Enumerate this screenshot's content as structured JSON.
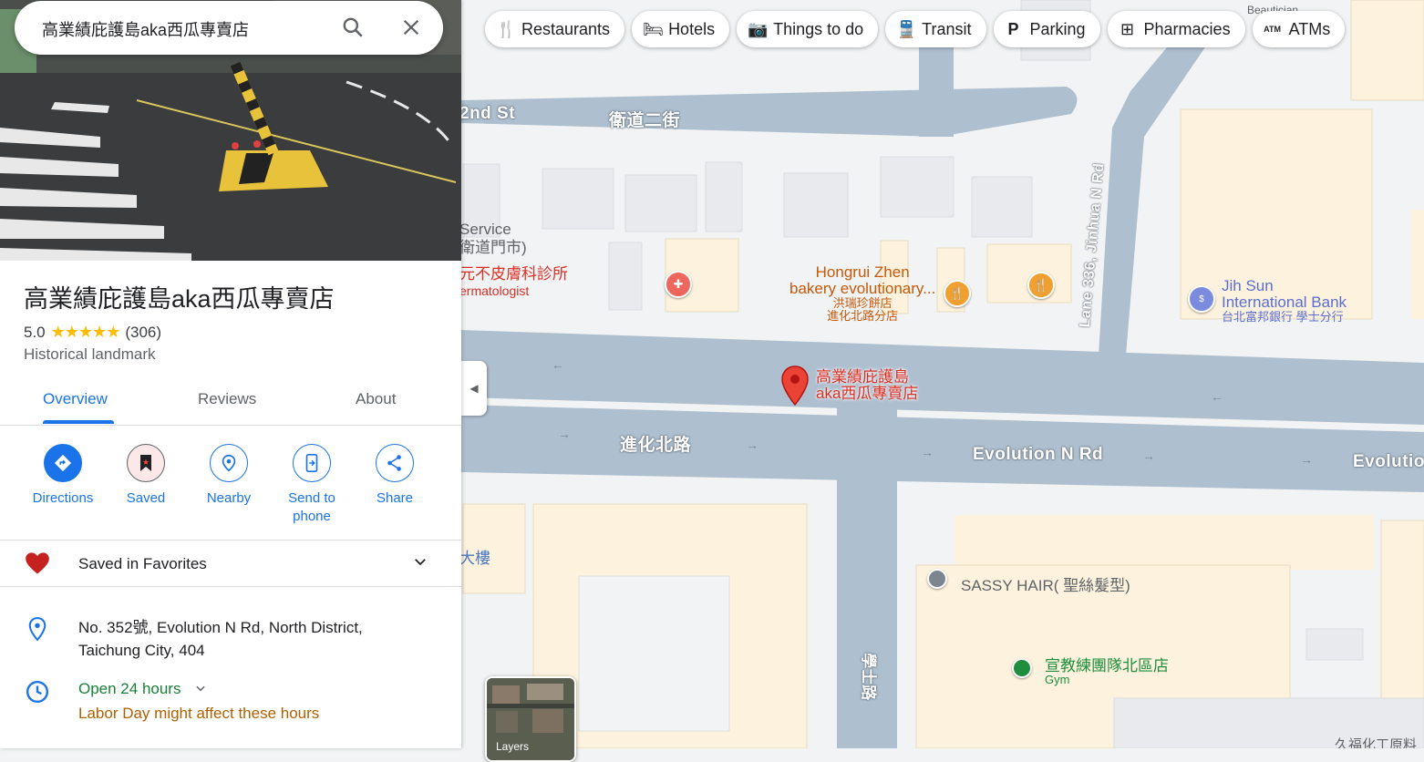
{
  "search": {
    "query": "高業績庇護島aka西瓜專賣店"
  },
  "chips": [
    {
      "label": "Restaurants",
      "icon": "fork-knife-icon"
    },
    {
      "label": "Hotels",
      "icon": "bed-icon"
    },
    {
      "label": "Things to do",
      "icon": "camera-icon"
    },
    {
      "label": "Transit",
      "icon": "train-icon"
    },
    {
      "label": "Parking",
      "icon": "parking-icon"
    },
    {
      "label": "Pharmacies",
      "icon": "pharmacy-icon"
    },
    {
      "label": "ATMs",
      "icon": "atm-icon"
    }
  ],
  "place": {
    "title": "高業績庇護島aka西瓜專賣店",
    "rating": "5.0",
    "stars": "★★★★★",
    "review_count": "(306)",
    "category": "Historical landmark"
  },
  "tabs": [
    "Overview",
    "Reviews",
    "About"
  ],
  "actions": [
    {
      "label": "Directions"
    },
    {
      "label": "Saved"
    },
    {
      "label": "Nearby"
    },
    {
      "label": "Send to phone"
    },
    {
      "label": "Share"
    }
  ],
  "saved_list": "Saved in Favorites",
  "address": "No. 352號, Evolution N Rd, North District, Taichung City, 404",
  "hours": {
    "status": "Open 24 hours",
    "note": "Labor Day might affect these hours"
  },
  "map": {
    "roads": {
      "r2nd_en": "2nd St",
      "r2nd_zh": "衛道二街",
      "evo_zh": "進化北路",
      "evo_en": "Evolution N Rd",
      "evo_en2": "Evolutio",
      "lane": "Lane 336, Jinhua N Rd",
      "xueshi": "學士路"
    },
    "labels": {
      "service_a": "Service",
      "service_b": "衛道門市)",
      "derm_zh": "元不皮膚科診所",
      "derm_en": "ermatologist",
      "hongrui_1": "Hongrui Zhen",
      "hongrui_2": "bakery evolutionary...",
      "hongrui_3": "洪瑞珍餅店",
      "hongrui_4": "進化北路分店",
      "bank_1": "Jih Sun",
      "bank_2": "International Bank",
      "bank_3": "台北富邦銀行 學士分行",
      "pin_1": "高業績庇護島",
      "pin_2": "aka西瓜專賣店",
      "building": "大樓",
      "sassy": "SASSY HAIR( 聖絲髮型)",
      "gym_1": "宣教練團隊北區店",
      "gym_2": "Gym",
      "beauty": "Beautician",
      "jiufu": "久福化工原料"
    },
    "layers_label": "Layers"
  },
  "colors": {
    "accent": "#1a73e8",
    "open": "#188038",
    "warn": "#b06000",
    "pin": "#ea4335"
  }
}
